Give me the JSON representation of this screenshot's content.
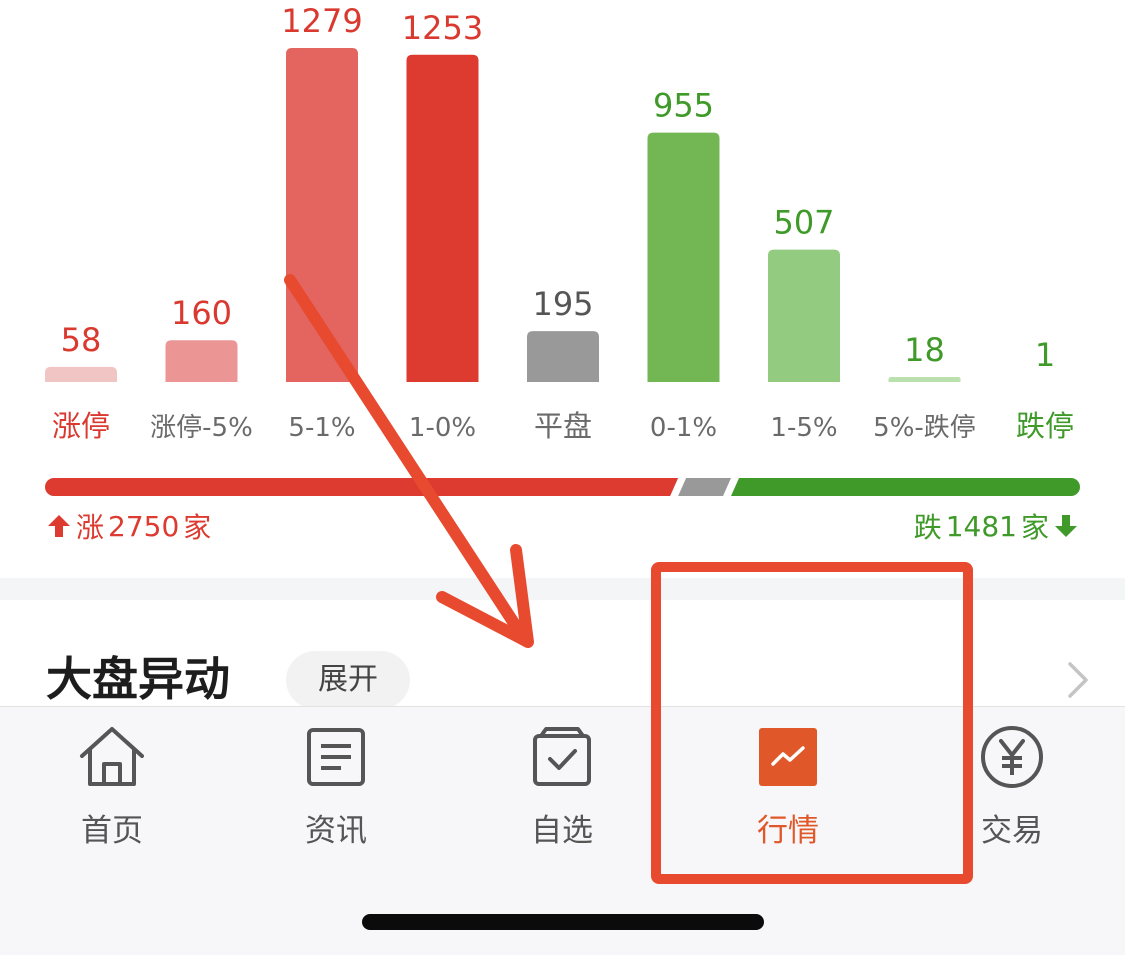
{
  "chart_data": {
    "type": "bar",
    "categories": [
      "涨停",
      "涨停-5%",
      "5-1%",
      "1-0%",
      "平盘",
      "0-1%",
      "1-5%",
      "5%-跌停",
      "跌停"
    ],
    "values": [
      58,
      160,
      1279,
      1253,
      195,
      955,
      507,
      18,
      1
    ],
    "colors": [
      "#f2c5c5",
      "#ec9595",
      "#e4655f",
      "#dd3a30",
      "#999999",
      "#73b755",
      "#93cb80",
      "#b9e0ad",
      "#8ec875"
    ],
    "label_colors": [
      "#d9392f",
      "#d9392f",
      "#d9392f",
      "#d9392f",
      "#555555",
      "#3f9a29",
      "#3f9a29",
      "#3f9a29",
      "#3f9a29"
    ],
    "category_label_colors": [
      "#d9392f",
      "#6a6a6a",
      "#6a6a6a",
      "#6a6a6a",
      "#6a6a6a",
      "#6a6a6a",
      "#6a6a6a",
      "#6a6a6a",
      "#3f9a29"
    ],
    "ylim": [
      0,
      1279
    ]
  },
  "breadth": {
    "up_count": 2750,
    "down_count": 1481,
    "flat_count": 195,
    "up_color": "#dd3a30",
    "down_color": "#3f9a29",
    "flat_color": "#999999"
  },
  "summary": {
    "up_label": "涨",
    "up_value": "2750",
    "down_label": "跌",
    "down_value": "1481",
    "unit": "家"
  },
  "section": {
    "title": "大盘异动",
    "expand_label": "展开"
  },
  "tabs": [
    {
      "label": "首页",
      "icon": "home-icon"
    },
    {
      "label": "资讯",
      "icon": "news-icon"
    },
    {
      "label": "自选",
      "icon": "watchlist-icon"
    },
    {
      "label": "行情",
      "icon": "market-icon"
    },
    {
      "label": "交易",
      "icon": "trade-icon"
    }
  ],
  "active_tab": "行情",
  "colors": {
    "accent": "#e0582a",
    "annotation": "#e84a2f",
    "rise": "#dd3a30",
    "fall": "#3f9a29"
  }
}
